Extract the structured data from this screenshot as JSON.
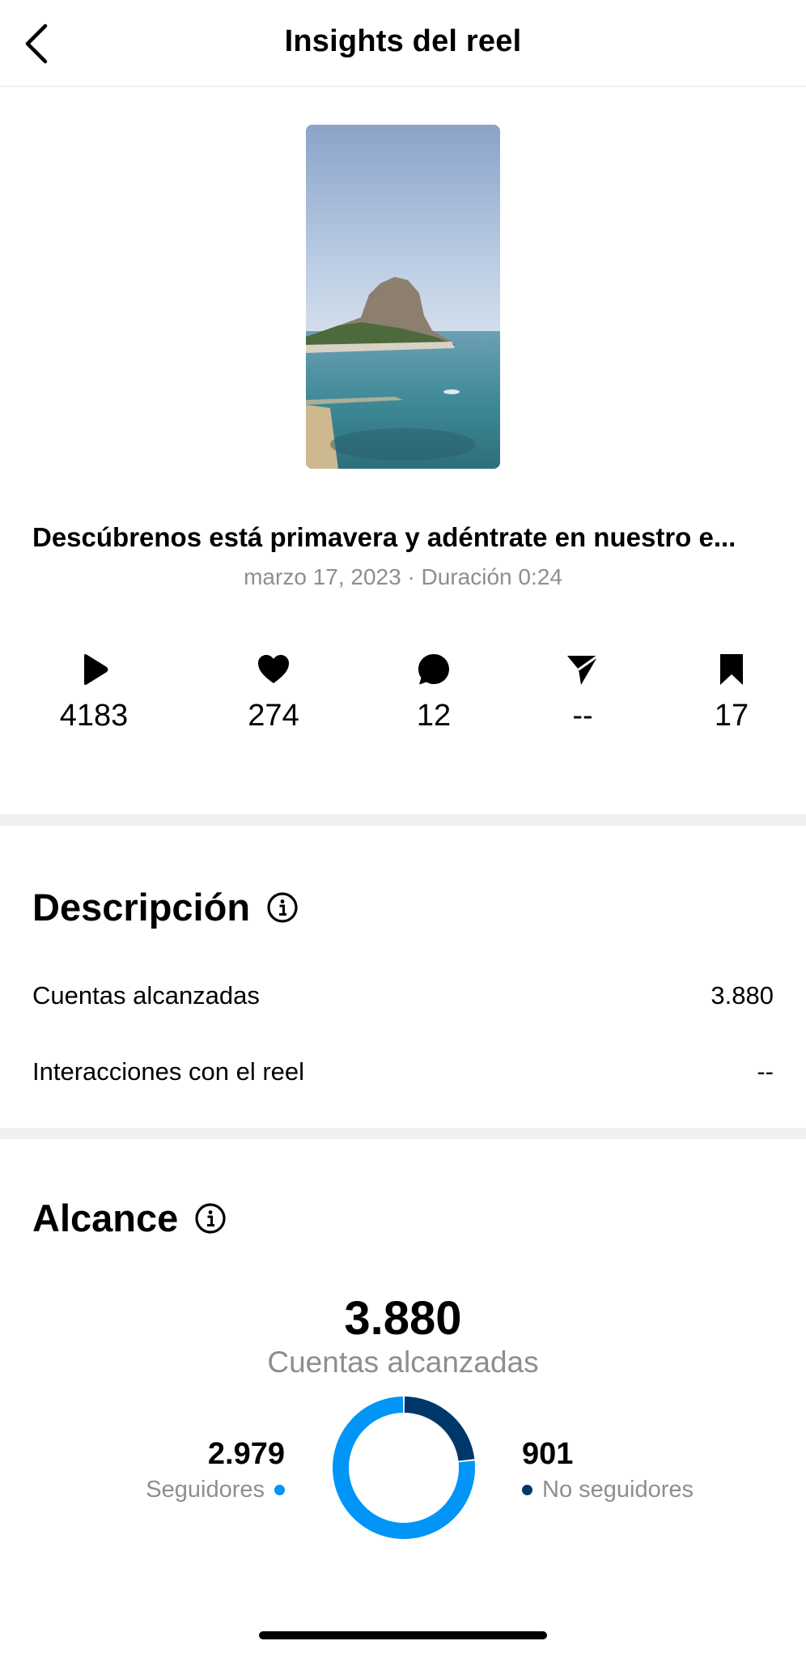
{
  "header": {
    "title": "Insights del reel",
    "back_icon": "chevron-left-icon"
  },
  "reel": {
    "caption": "Descúbrenos está primavera y adéntrate en nuestro e...",
    "meta": "marzo 17, 2023 · Duración 0:24"
  },
  "stats": [
    {
      "icon": "play-icon",
      "value": "4183"
    },
    {
      "icon": "heart-icon",
      "value": "274"
    },
    {
      "icon": "comment-icon",
      "value": "12"
    },
    {
      "icon": "share-icon",
      "value": "--"
    },
    {
      "icon": "bookmark-icon",
      "value": "17"
    }
  ],
  "descripcion": {
    "title": "Descripción",
    "rows": [
      {
        "label": "Cuentas alcanzadas",
        "value": "3.880"
      },
      {
        "label": "Interacciones con el reel",
        "value": "--"
      }
    ]
  },
  "alcance": {
    "title": "Alcance",
    "total": "3.880",
    "total_label": "Cuentas alcanzadas",
    "followers": {
      "value": "2.979",
      "label": "Seguidores",
      "color": "#0095f6"
    },
    "non_followers": {
      "value": "901",
      "label": "No seguidores",
      "color": "#00376b"
    }
  },
  "chart_data": {
    "type": "pie",
    "categories": [
      "Seguidores",
      "No seguidores"
    ],
    "values": [
      2979,
      901
    ],
    "colors": [
      "#0095f6",
      "#00376b"
    ]
  }
}
